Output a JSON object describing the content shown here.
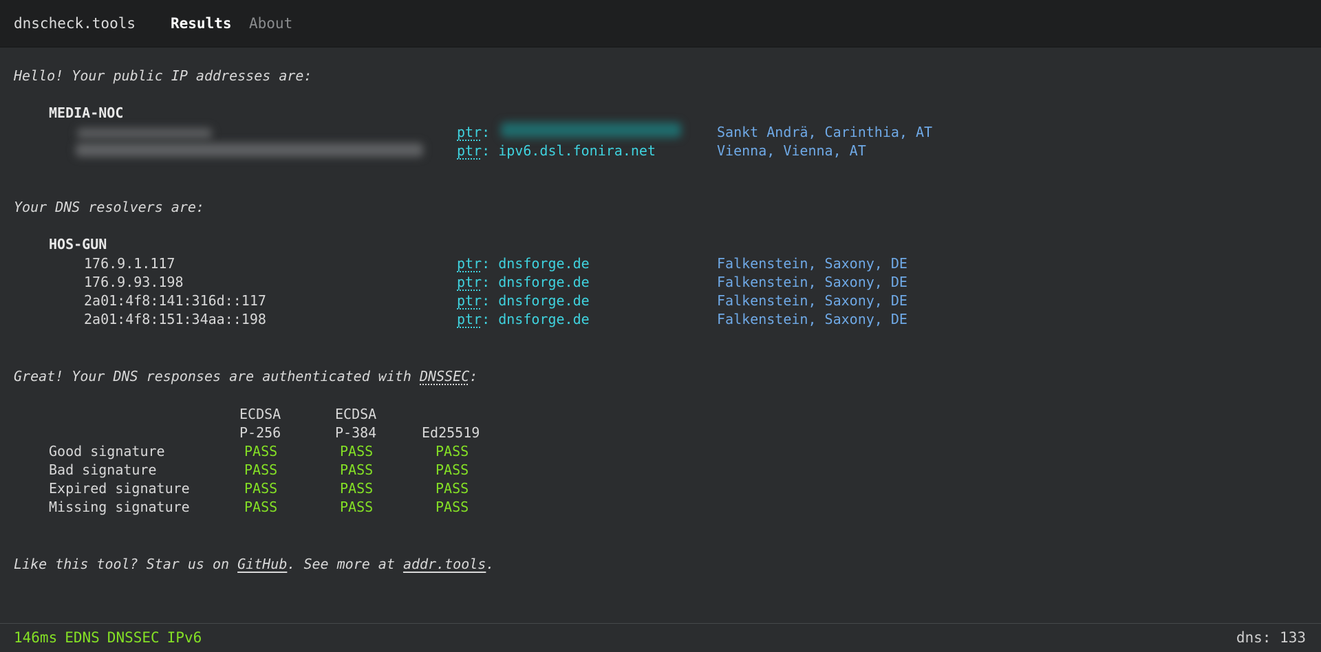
{
  "nav": {
    "brand": "dnscheck.tools",
    "results": "Results",
    "about": "About"
  },
  "ip_section": {
    "intro": "Hello! Your public IP addresses are:",
    "provider": "MEDIA-NOC",
    "rows": [
      {
        "ptr_label": "ptr",
        "ptr_value": "",
        "location": "Sankt Andrä, Carinthia, AT"
      },
      {
        "ptr_label": "ptr",
        "ptr_value": "ipv6.dsl.fonira.net",
        "location": "Vienna, Vienna, AT"
      }
    ]
  },
  "resolver_section": {
    "intro": "Your DNS resolvers are:",
    "provider": "HOS-GUN",
    "rows": [
      {
        "ip": "176.9.1.117",
        "ptr_label": "ptr",
        "ptr_value": "dnsforge.de",
        "location": "Falkenstein, Saxony, DE"
      },
      {
        "ip": "176.9.93.198",
        "ptr_label": "ptr",
        "ptr_value": "dnsforge.de",
        "location": "Falkenstein, Saxony, DE"
      },
      {
        "ip": "2a01:4f8:141:316d::117",
        "ptr_label": "ptr",
        "ptr_value": "dnsforge.de",
        "location": "Falkenstein, Saxony, DE"
      },
      {
        "ip": "2a01:4f8:151:34aa::198",
        "ptr_label": "ptr",
        "ptr_value": "dnsforge.de",
        "location": "Falkenstein, Saxony, DE"
      }
    ]
  },
  "dnssec_section": {
    "intro_prefix": "Great! Your DNS responses are authenticated with ",
    "intro_link": "DNSSEC",
    "intro_suffix": ":",
    "columns": [
      {
        "line1": "ECDSA",
        "line2": "P-256"
      },
      {
        "line1": "ECDSA",
        "line2": "P-384"
      },
      {
        "line1": "",
        "line2": "Ed25519"
      }
    ],
    "rows": [
      {
        "label": "Good signature",
        "results": [
          "PASS",
          "PASS",
          "PASS"
        ]
      },
      {
        "label": "Bad signature",
        "results": [
          "PASS",
          "PASS",
          "PASS"
        ]
      },
      {
        "label": "Expired signature",
        "results": [
          "PASS",
          "PASS",
          "PASS"
        ]
      },
      {
        "label": "Missing signature",
        "results": [
          "PASS",
          "PASS",
          "PASS"
        ]
      }
    ]
  },
  "promo": {
    "prefix": "Like this tool? Star us on ",
    "github": "GitHub",
    "middle": ". See more at ",
    "addr": "addr.tools",
    "suffix": "."
  },
  "footer": {
    "latency": "146ms",
    "edns": "EDNS",
    "dnssec": "DNSSEC",
    "ipv6": "IPv6",
    "dns_count": "dns: 133"
  },
  "colors": {
    "pass": "#84e025",
    "ptr": "#3fd2de",
    "location": "#6fa9e6",
    "background": "#2b2d2f"
  }
}
